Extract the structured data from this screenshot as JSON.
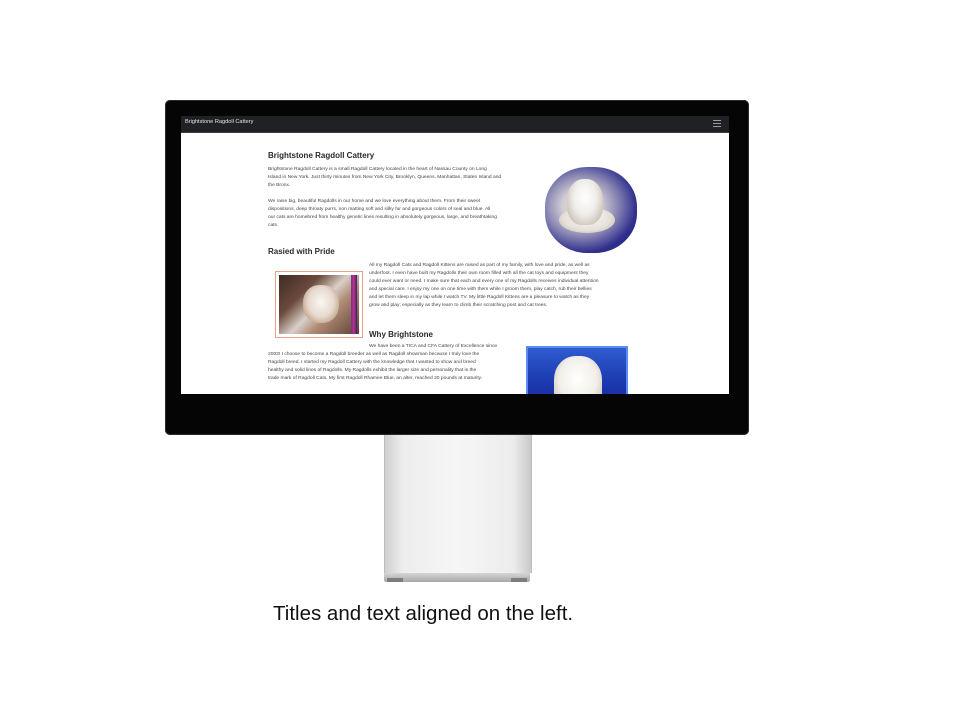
{
  "navbar": {
    "brand": "Brightstone Ragdoll Cattery"
  },
  "sections": [
    {
      "title": "Brightstone Ragdoll Cattery",
      "paragraphs": [
        [
          "Brightstone Ragdoll Cattery is a small Ragdoll Cattery located in the heart of Nassau County on Long",
          "Island in New York. Just thirty minutes from New York City, Brooklyn, Queens, Manhattan, Staten Island and",
          "the Bronx."
        ],
        [
          "We raise big, beautiful Ragdolls in our home and we love everything about them. From their sweet",
          "dispositions, deep throaty purrs, non matting soft and silky fur and gorgeous colors of seal and blue. All",
          "our cats are homebred from healthy genetic lines resulting in absolutely gorgeous, large, and breathtaking",
          "cats."
        ]
      ]
    },
    {
      "title": "Rasied with Pride",
      "paragraphs": [
        [
          "All my Ragdoll Cats and Ragdoll Kittens are raised as part of my family, with love and pride, as well as",
          "underfoot. I even have built my Ragdolls their own room filled with all the cat toys and equipment they",
          "could ever want or need. I make sure that each and every one of my Ragdolls receives individual attention",
          "and special care. I enjoy my one on one time with them while I groom them, play catch, rub their bellies",
          "and let them sleep in my lap while I watch TV. My little Ragdoll Kittens are a pleasure to watch as they",
          "grow and play; especially as they learn to climb their scratching post and cat trees."
        ]
      ]
    },
    {
      "title": "Why Brightstone",
      "paragraphs": [
        [
          "We have been a TICA and CFA Cattery of Excellence since",
          "2003! I choose to become a Ragdoll breeder as well as Ragdoll showman because I truly love the",
          "Ragdoll breed. I started my Ragdoll Cattery with the knowledge that I wanted to show and breed",
          "healthy and solid lines of Ragdolls. My Ragdolls exhibit the larger size and personality that is the",
          "trade mark of Ragdoll Cats. My first Ragdoll Rhamee Blue, an alter, reached 20 pounds at maturity."
        ]
      ]
    }
  ],
  "caption": "Titles and text aligned on the left."
}
